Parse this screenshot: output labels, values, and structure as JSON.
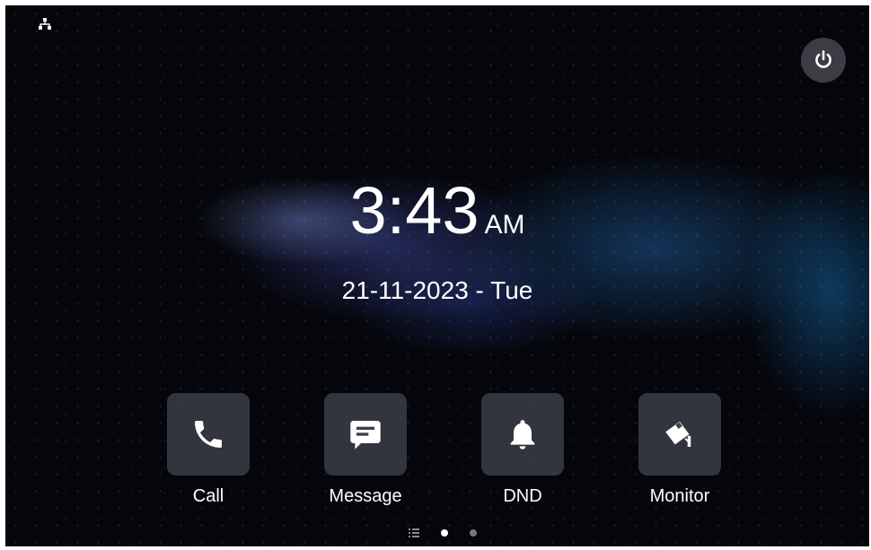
{
  "status_bar": {
    "network_icon": "network-icon",
    "power_icon": "power-icon"
  },
  "clock": {
    "time": "3:43",
    "ampm": "AM",
    "date": "21-11-2023 - Tue"
  },
  "apps": [
    {
      "label": "Call",
      "icon": "phone-icon"
    },
    {
      "label": "Message",
      "icon": "message-icon"
    },
    {
      "label": "DND",
      "icon": "bell-icon"
    },
    {
      "label": "Monitor",
      "icon": "camera-icon"
    }
  ],
  "pager": {
    "pages": 2,
    "active": 0
  },
  "colors": {
    "tile": "#3c3e48",
    "text": "#ffffff",
    "power_bg": "#5a5a64"
  }
}
